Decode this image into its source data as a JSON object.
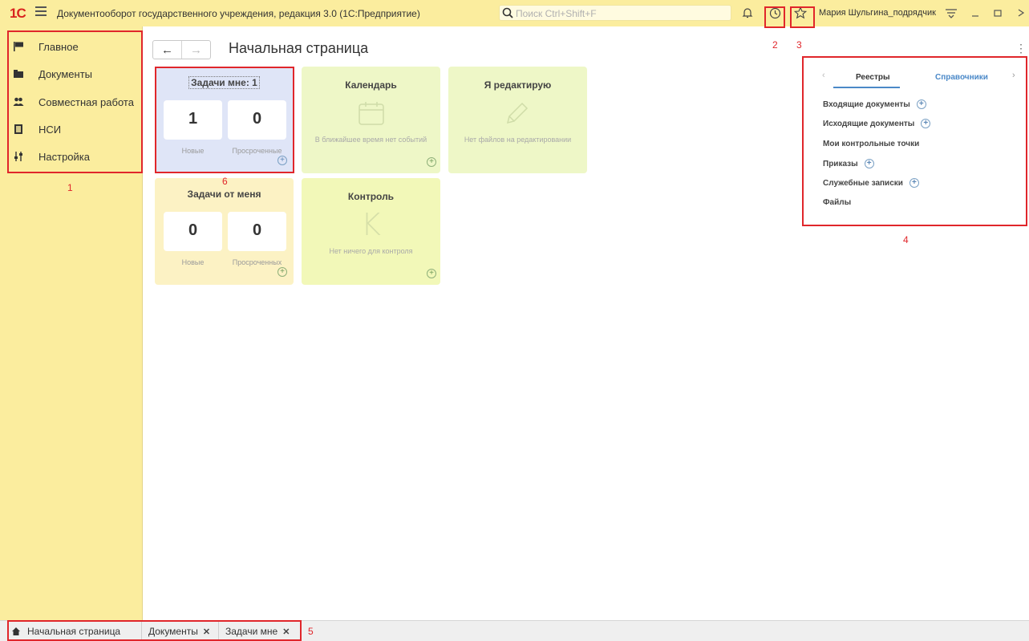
{
  "app": {
    "logo": "1С",
    "title": "Документооборот государственного учреждения, редакция 3.0  (1С:Предприятие)",
    "search_placeholder": "Поиск Ctrl+Shift+F",
    "user_name": "Мария Шульгина_подрядчик"
  },
  "sidebar": {
    "items": [
      {
        "label": "Главное",
        "icon": "flag-icon"
      },
      {
        "label": "Документы",
        "icon": "folder-icon"
      },
      {
        "label": "Совместная работа",
        "icon": "people-icon"
      },
      {
        "label": "НСИ",
        "icon": "book-icon"
      },
      {
        "label": "Настройка",
        "icon": "sliders-icon"
      }
    ]
  },
  "page": {
    "title": "Начальная страница"
  },
  "tiles": {
    "tasks_to_me": {
      "title": "Задачи мне: 1",
      "new_count": "1",
      "overdue_count": "0",
      "new_label": "Новые",
      "overdue_label": "Просроченные"
    },
    "calendar": {
      "title": "Календарь",
      "empty_text": "В ближайшее время нет событий"
    },
    "editing": {
      "title": "Я редактирую",
      "empty_text": "Нет файлов на редактировании"
    },
    "tasks_from_me": {
      "title": "Задачи от меня",
      "new_count": "0",
      "overdue_count": "0",
      "new_label": "Новые",
      "overdue_label": "Просроченных"
    },
    "control": {
      "title": "Контроль",
      "letter": "K",
      "empty_text": "Нет ничего для контроля"
    }
  },
  "registers": {
    "tabs": [
      "Реестры",
      "Справочники"
    ],
    "items": [
      {
        "label": "Входящие документы",
        "has_add": true
      },
      {
        "label": "Исходящие документы",
        "has_add": true
      },
      {
        "label": "Мои контрольные точки",
        "has_add": false
      },
      {
        "label": "Приказы",
        "has_add": true
      },
      {
        "label": "Служебные записки",
        "has_add": true
      },
      {
        "label": "Файлы",
        "has_add": false
      }
    ]
  },
  "bottom_tabs": [
    {
      "label": "Начальная страница"
    },
    {
      "label": "Документы"
    },
    {
      "label": "Задачи мне"
    }
  ],
  "annotations": [
    "1",
    "2",
    "3",
    "4",
    "5",
    "6"
  ],
  "colors": {
    "titlebar": "#fbed9e",
    "tile_blue": "#dfe5f7",
    "tile_green": "#eef7c7",
    "tile_yellow": "#fcf2c4",
    "annotation_red": "#e0262b"
  }
}
